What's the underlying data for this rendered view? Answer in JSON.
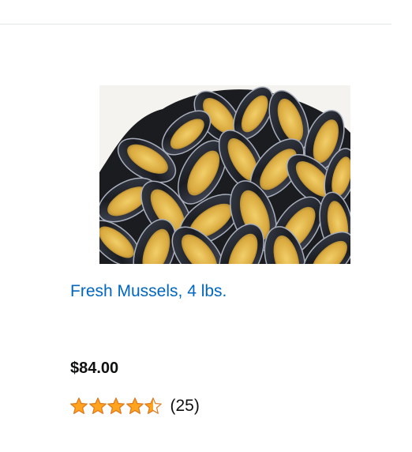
{
  "product": {
    "title": "Fresh Mussels, 4 lbs.",
    "price": "$84.00",
    "rating": 4.5,
    "rating_max": 5,
    "review_count": "(25)",
    "image_icon": "mussels-photo"
  },
  "colors": {
    "link": "#0066c0",
    "star_fill": "#ffa41c",
    "star_stroke": "#de7921",
    "text": "#0f1111",
    "divider": "#e3e6e6"
  }
}
